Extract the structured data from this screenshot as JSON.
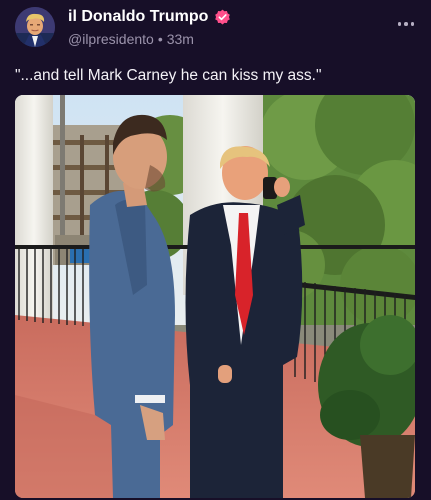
{
  "post": {
    "author": {
      "display_name": "il Donaldo Trumpo",
      "handle": "@ilpresidento",
      "separator": "•",
      "time_ago": "33m",
      "verified": true
    },
    "text": "\"...and tell Mark Carney he can kiss my ass.\"",
    "image": {
      "icon": "photo-image"
    },
    "menu": {
      "icon": "more-icon"
    }
  },
  "colors": {
    "background": "#170f28",
    "verified_badge": "#ff4f8b",
    "handle_text": "#9b93ab"
  }
}
